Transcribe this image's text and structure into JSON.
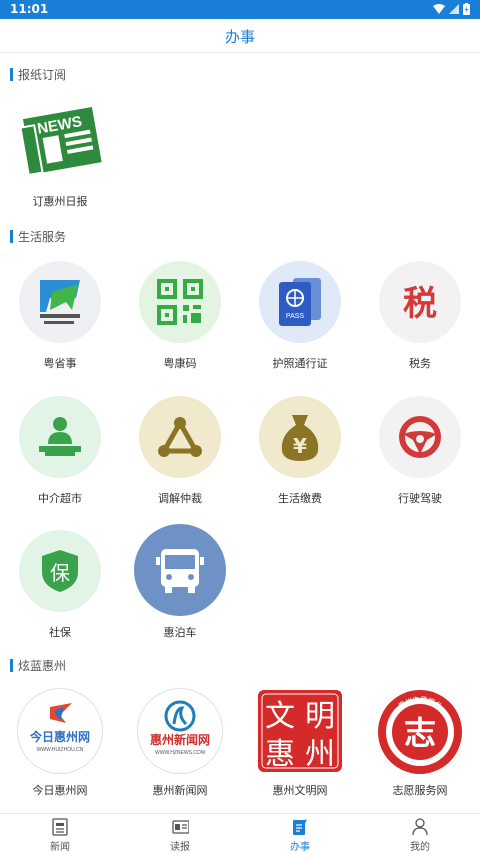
{
  "status_bar": {
    "time": "11:01"
  },
  "header": {
    "title": "办事"
  },
  "sections": {
    "newspaper": {
      "title": "报纸订阅",
      "items": [
        {
          "label": "订惠州日报"
        }
      ]
    },
    "life": {
      "title": "生活服务",
      "items": [
        {
          "label": "粤省事"
        },
        {
          "label": "粤康码"
        },
        {
          "label": "护照通行证"
        },
        {
          "label": "税务"
        },
        {
          "label": "中介超市"
        },
        {
          "label": "调解仲裁"
        },
        {
          "label": "生活缴费"
        },
        {
          "label": "行驶驾驶"
        },
        {
          "label": "社保"
        },
        {
          "label": "惠泊车"
        }
      ]
    },
    "links": {
      "title": "炫蓝惠州",
      "items": [
        {
          "label": "今日惠州网",
          "logo_text": "今日惠州网",
          "logo_sub": "WWW.HUIZHOU.CN"
        },
        {
          "label": "惠州新闻网",
          "logo_text": "惠州新闻网",
          "logo_sub": "WWW.HZNEWS.COM"
        },
        {
          "label": "惠州文明网",
          "seal_chars": [
            "文",
            "明",
            "惠",
            "州"
          ]
        },
        {
          "label": "志愿服务网",
          "seal_char": "志",
          "ring_top": "惠州志愿服务",
          "ring_bottom": "Huizhou Volunteer Service"
        }
      ]
    }
  },
  "icon_text": {
    "pass": "PASS",
    "tax": "税",
    "fee": "¥",
    "news": "NEWS",
    "baby": "保"
  },
  "tabs": [
    {
      "label": "新闻"
    },
    {
      "label": "读报"
    },
    {
      "label": "办事"
    },
    {
      "label": "我的"
    }
  ],
  "colors": {
    "accent": "#1a7fd6"
  }
}
